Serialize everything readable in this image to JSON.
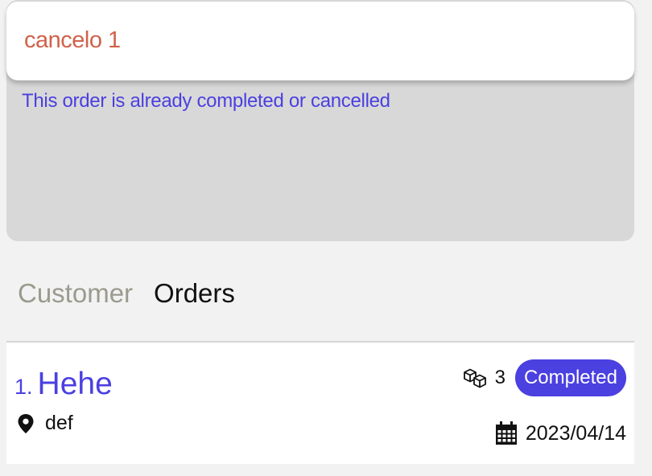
{
  "alert": {
    "title": "cancelo 1",
    "message": "This order is already completed or cancelled"
  },
  "tabs": [
    {
      "label": "Customer",
      "active": false
    },
    {
      "label": "Orders",
      "active": true
    }
  ],
  "orders": [
    {
      "index": "1.",
      "name": "Hehe",
      "address": "def",
      "quantity": "3",
      "status": "Completed",
      "date": "2023/04/14"
    }
  ],
  "colors": {
    "accent": "#4b40e0",
    "alert_title": "#d0624a",
    "tab_inactive": "#9a9a8e"
  },
  "icons": {
    "address": "map-pin-icon",
    "quantity": "boxes-icon",
    "date": "calendar-icon"
  }
}
